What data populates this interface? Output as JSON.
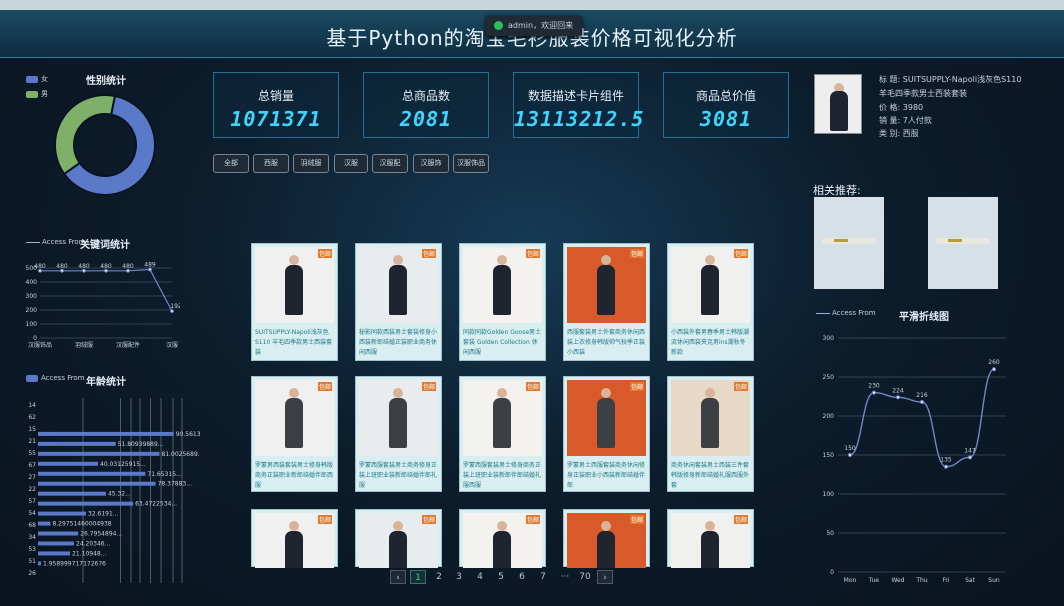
{
  "toast": "admin，欢迎回来",
  "title": "基于Python的淘宝毛衫服装价格可视化分析",
  "gender": {
    "title": "性别统计",
    "legend": [
      "女",
      "男"
    ],
    "colors": [
      "#5a79c8",
      "#7fb06a"
    ],
    "values": [
      62,
      38
    ]
  },
  "keywords": {
    "title": "关键词统计",
    "legend": "Access From",
    "x": [
      "汉服饰品",
      "羽绒服",
      "汉服配件",
      "汉服"
    ],
    "yticks": [
      "500",
      "400",
      "300",
      "200",
      "100",
      "0"
    ],
    "points": [
      {
        "x": 0,
        "y": 480,
        "label": "480"
      },
      {
        "x": 0.5,
        "y": 480,
        "label": "480"
      },
      {
        "x": 1,
        "y": 480,
        "label": "480"
      },
      {
        "x": 1.5,
        "y": 480,
        "label": "480"
      },
      {
        "x": 2,
        "y": 480,
        "label": "480"
      },
      {
        "x": 2.5,
        "y": 489,
        "label": "489"
      },
      {
        "x": 3,
        "y": 192,
        "label": "192"
      }
    ]
  },
  "age": {
    "title": "年龄统计",
    "legend": "Access From",
    "yticks": [
      "14",
      "62",
      "15",
      "21",
      "55",
      "67",
      "27",
      "22",
      "57",
      "54",
      "68",
      "34",
      "53",
      "51",
      "26"
    ],
    "bars": [
      {
        "v": 90.5,
        "t": "90.56131..."
      },
      {
        "v": 51.8,
        "t": "51.80939889..."
      },
      {
        "v": 81.0,
        "t": "81.0025689..."
      },
      {
        "v": 40.0,
        "t": "40.03125915..."
      },
      {
        "v": 71.6,
        "t": "71.65315..."
      },
      {
        "v": 78.4,
        "t": "78.37883..."
      },
      {
        "v": 45.3,
        "t": "45.32..."
      },
      {
        "v": 63.4,
        "t": "63.4722534..."
      },
      {
        "v": 32.0,
        "t": "32.6191..."
      },
      {
        "v": 8.3,
        "t": "8.29751460004938"
      },
      {
        "v": 26.8,
        "t": "26.7954894..."
      },
      {
        "v": 24.0,
        "t": "24.20346..."
      },
      {
        "v": 21.4,
        "t": "21.10948..."
      },
      {
        "v": 2.0,
        "t": "1.958999717172676"
      }
    ]
  },
  "cards": [
    {
      "label": "总销量",
      "value": "1071371"
    },
    {
      "label": "总商品数",
      "value": "2081"
    },
    {
      "label": "数据描述卡片组件",
      "value": "13113212.5"
    },
    {
      "label": "商品总价值",
      "value": "3081"
    }
  ],
  "filters": [
    "全部",
    "西服",
    "羽绒服",
    "汉服",
    "汉服配",
    "汉服饰",
    "汉服饰品"
  ],
  "products": [
    {
      "tag": "包邮",
      "text": "SUITSUPPLY-Napoli浅灰色S110 羊毛四季款男士西装套装"
    },
    {
      "tag": "包邮",
      "text": "秘影同款西装男士套装修身小西装新郎结婚正装职业商务休闲西服"
    },
    {
      "tag": "包邮",
      "text": "同款同款Golden Goose男士套装 Golden Collection 休闲西服"
    },
    {
      "tag": "包邮",
      "text": "西服套装男士外套商务休闲西装上衣修身韩版帅气秋季正装小西装"
    },
    {
      "tag": "包邮",
      "text": "小西装外套男春季男士韩版潮流休闲西装夹克男ins潮秋冬新款"
    },
    {
      "tag": "包邮",
      "text": "罗蒙男西装套装男士修身韩版商务正装职业新郎结婚伴郎西服"
    },
    {
      "tag": "包邮",
      "text": "罗蒙西服套装男士商务修身正装上班职业装新郎结婚伴郎礼服"
    },
    {
      "tag": "包邮",
      "text": "罗蒙西服套装男士修身商务正装上班职业装新郎伴郎结婚礼服西服"
    },
    {
      "tag": "包邮",
      "text": "罗蒙男士西服套装商务休闲修身正装职业小西装新郎结婚伴郎"
    },
    {
      "tag": "包邮",
      "text": "商务休闲套装男士西装三件套韩版修身新郎结婚礼服西服外套"
    },
    {
      "tag": "包邮",
      "text": ""
    },
    {
      "tag": "包邮",
      "text": ""
    },
    {
      "tag": "包邮",
      "text": ""
    },
    {
      "tag": "包邮",
      "text": ""
    },
    {
      "tag": "包邮",
      "text": ""
    }
  ],
  "pagination": {
    "pages": [
      "1",
      "2",
      "3",
      "4",
      "5",
      "6",
      "7",
      "···",
      "70"
    ],
    "prev": "‹",
    "next": "›"
  },
  "detail": {
    "title": "标 题: SUITSUPPLY-Napoli浅灰色S110",
    "subtitle": "羊毛四季款男士西装套装",
    "price": "价 格: 3980",
    "sales": "销 量: 7人付款",
    "category": "类 别: 西服"
  },
  "related": {
    "title": "相关推荐:"
  },
  "smooth": {
    "title": "平滑折线图",
    "legend": "Access From",
    "x": [
      "Mon",
      "Tue",
      "Wed",
      "Thu",
      "Fri",
      "Sat",
      "Sun"
    ],
    "yticks": [
      "300",
      "250",
      "200",
      "150",
      "100",
      "50",
      "0"
    ],
    "values": [
      150,
      230,
      224,
      218,
      135,
      147,
      260
    ],
    "labels": [
      "150",
      "230",
      "224",
      "216",
      "135",
      "147",
      "260"
    ]
  }
}
